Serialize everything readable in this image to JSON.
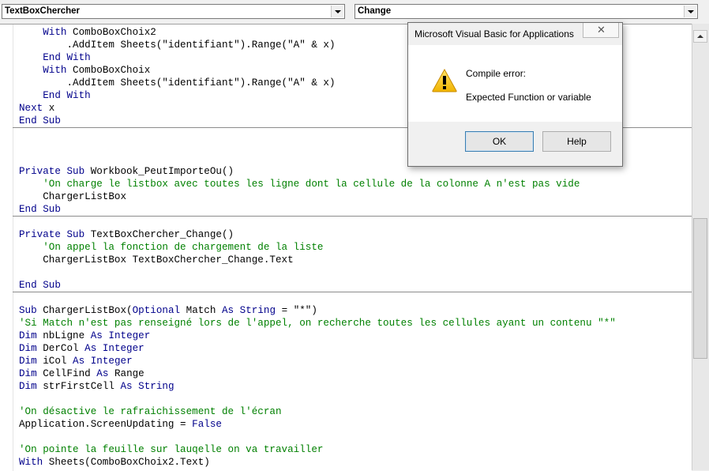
{
  "object_combo": {
    "value": "TextBoxChercher"
  },
  "procedure_combo": {
    "value": "Change"
  },
  "code_lines": [
    {
      "segments": [
        {
          "t": "    "
        },
        {
          "t": "With",
          "k": "kw"
        },
        {
          "t": " ComboBoxChoix2"
        }
      ]
    },
    {
      "segments": [
        {
          "t": "        .AddItem Sheets(\"identifiant\").Range(\"A\" & x)"
        }
      ]
    },
    {
      "segments": [
        {
          "t": "    "
        },
        {
          "t": "End With",
          "k": "kw"
        }
      ]
    },
    {
      "segments": [
        {
          "t": "    "
        },
        {
          "t": "With",
          "k": "kw"
        },
        {
          "t": " ComboBoxChoix"
        }
      ]
    },
    {
      "segments": [
        {
          "t": "        .AddItem Sheets(\"identifiant\").Range(\"A\" & x)"
        }
      ]
    },
    {
      "segments": [
        {
          "t": "    "
        },
        {
          "t": "End With",
          "k": "kw"
        }
      ]
    },
    {
      "segments": [
        {
          "t": "Next",
          "k": "kw"
        },
        {
          "t": " x"
        }
      ]
    },
    {
      "segments": [
        {
          "t": "End Sub",
          "k": "kw"
        }
      ]
    },
    {
      "segments": []
    },
    {
      "segments": []
    },
    {
      "segments": []
    },
    {
      "segments": [
        {
          "t": "Private Sub",
          "k": "kw"
        },
        {
          "t": " Workbook_PeutImporteOu()"
        }
      ]
    },
    {
      "segments": [
        {
          "t": "    "
        },
        {
          "t": "'On charge le listbox avec toutes les ligne dont la cellule de la colonne A n'est pas vide",
          "k": "cm"
        }
      ]
    },
    {
      "segments": [
        {
          "t": "    ChargerListBox"
        }
      ]
    },
    {
      "segments": [
        {
          "t": "End Sub",
          "k": "kw"
        }
      ]
    },
    {
      "segments": []
    },
    {
      "segments": [
        {
          "t": "Private Sub",
          "k": "kw"
        },
        {
          "t": " TextBoxChercher_Change()"
        }
      ]
    },
    {
      "segments": [
        {
          "t": "    "
        },
        {
          "t": "'On appel la fonction de chargement de la liste",
          "k": "cm"
        }
      ]
    },
    {
      "segments": [
        {
          "t": "    ChargerListBox TextBoxChercher_Change.Text"
        }
      ]
    },
    {
      "segments": []
    },
    {
      "segments": [
        {
          "t": "End Sub",
          "k": "kw"
        }
      ]
    },
    {
      "segments": []
    },
    {
      "segments": [
        {
          "t": "Sub",
          "k": "kw"
        },
        {
          "t": " ChargerListBox("
        },
        {
          "t": "Optional",
          "k": "kw"
        },
        {
          "t": " Match "
        },
        {
          "t": "As String",
          "k": "kw"
        },
        {
          "t": " = \"*\")"
        }
      ]
    },
    {
      "segments": [
        {
          "t": "'Si Match n'est pas renseigné lors de l'appel, on recherche toutes les cellules ayant un contenu \"*\"",
          "k": "cm"
        }
      ]
    },
    {
      "segments": [
        {
          "t": "Dim",
          "k": "kw"
        },
        {
          "t": " nbLigne "
        },
        {
          "t": "As Integer",
          "k": "kw"
        }
      ]
    },
    {
      "segments": [
        {
          "t": "Dim",
          "k": "kw"
        },
        {
          "t": " DerCol "
        },
        {
          "t": "As Integer",
          "k": "kw"
        }
      ]
    },
    {
      "segments": [
        {
          "t": "Dim",
          "k": "kw"
        },
        {
          "t": " iCol "
        },
        {
          "t": "As Integer",
          "k": "kw"
        }
      ]
    },
    {
      "segments": [
        {
          "t": "Dim",
          "k": "kw"
        },
        {
          "t": " CellFind "
        },
        {
          "t": "As",
          "k": "kw"
        },
        {
          "t": " Range"
        }
      ]
    },
    {
      "segments": [
        {
          "t": "Dim",
          "k": "kw"
        },
        {
          "t": " strFirstCell "
        },
        {
          "t": "As String",
          "k": "kw"
        }
      ]
    },
    {
      "segments": []
    },
    {
      "segments": [
        {
          "t": "'On désactive le rafraichissement de l'écran",
          "k": "cm"
        }
      ]
    },
    {
      "segments": [
        {
          "t": "Application.ScreenUpdating = "
        },
        {
          "t": "False",
          "k": "kw"
        }
      ]
    },
    {
      "segments": []
    },
    {
      "segments": [
        {
          "t": "'On pointe la feuille sur lauqelle on va travailler",
          "k": "cm"
        }
      ]
    },
    {
      "segments": [
        {
          "t": "With",
          "k": "kw"
        },
        {
          "t": " Sheets(ComboBoxChoix2.Text)"
        }
      ]
    }
  ],
  "dialog": {
    "title": "Microsoft Visual Basic for Applications",
    "close_glyph": "✕",
    "heading": "Compile error:",
    "message": "Expected Function or variable",
    "ok_label": "OK",
    "help_label": "Help",
    "icon": "warning-icon"
  },
  "colors": {
    "keyword": "#00008b",
    "comment": "#008000",
    "text": "#000000"
  }
}
